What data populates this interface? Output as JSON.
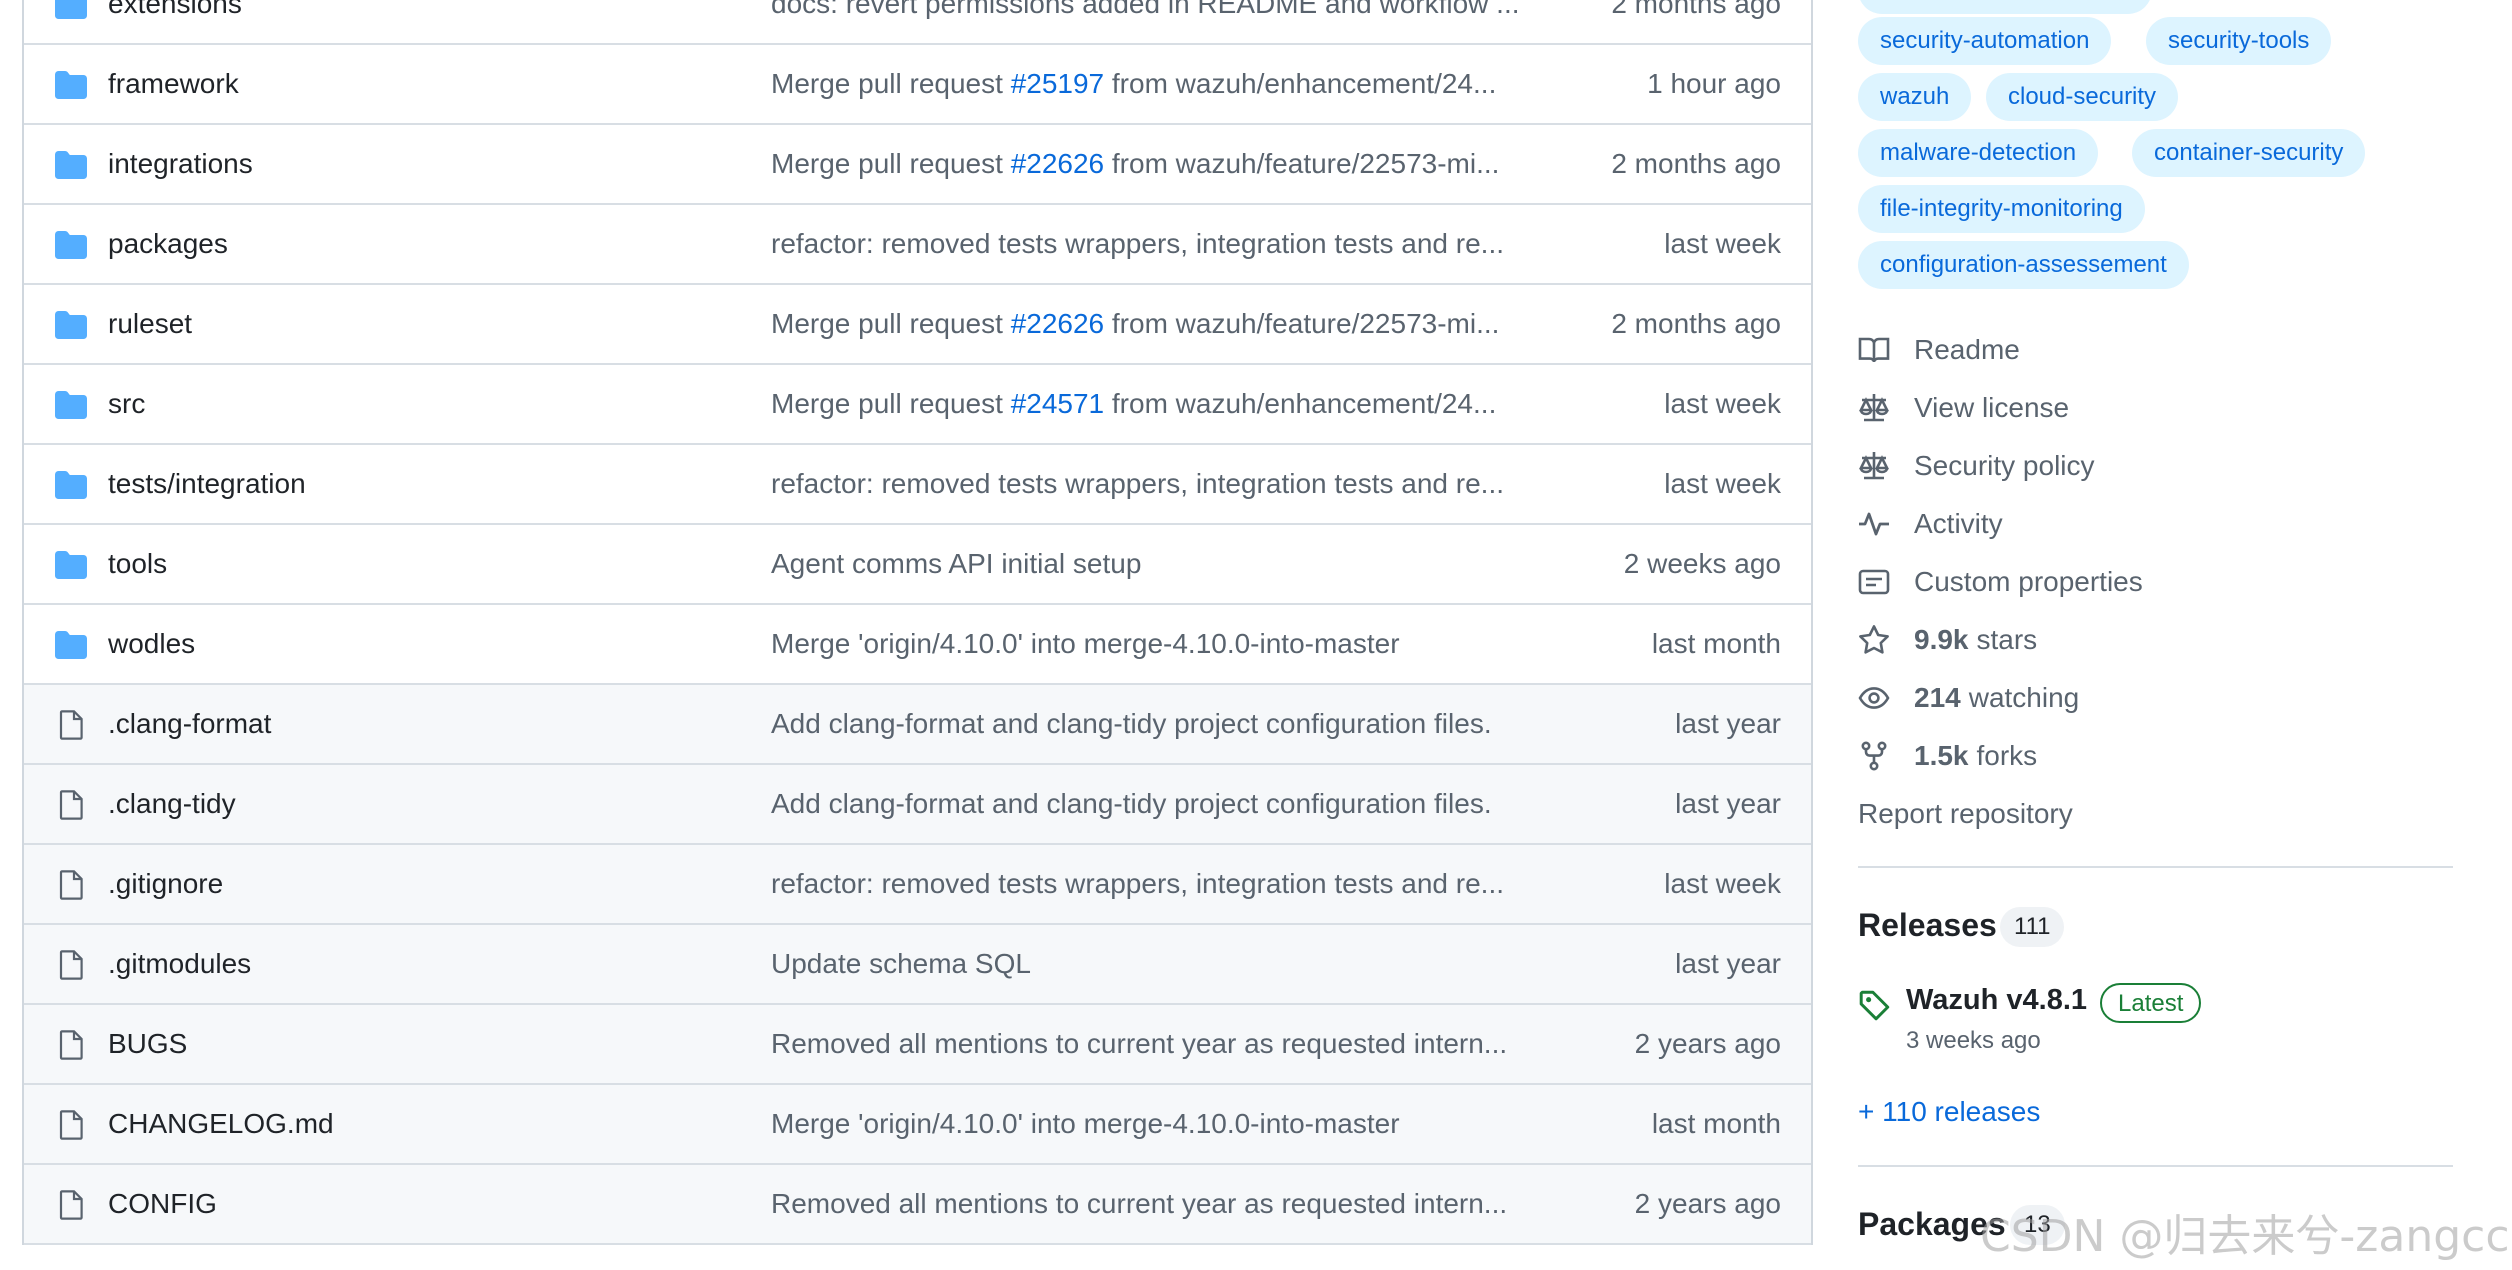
{
  "files": [
    {
      "type": "dir",
      "name": "extensions",
      "message": "docs: revert permissions added in README and workflow ...",
      "message_parts": [],
      "age": "2 months ago"
    },
    {
      "type": "dir",
      "name": "framework",
      "message_pre": "Merge pull request ",
      "pr": "#25197",
      "message_post": " from wazuh/enhancement/24...",
      "age": "1 hour ago"
    },
    {
      "type": "dir",
      "name": "integrations",
      "message_pre": "Merge pull request ",
      "pr": "#22626",
      "message_post": " from wazuh/feature/22573-mi...",
      "age": "2 months ago"
    },
    {
      "type": "dir",
      "name": "packages",
      "message": "refactor: removed tests wrappers, integration tests and re...",
      "age": "last week"
    },
    {
      "type": "dir",
      "name": "ruleset",
      "message_pre": "Merge pull request ",
      "pr": "#22626",
      "message_post": " from wazuh/feature/22573-mi...",
      "age": "2 months ago"
    },
    {
      "type": "dir",
      "name": "src",
      "message_pre": "Merge pull request ",
      "pr": "#24571",
      "message_post": " from wazuh/enhancement/24...",
      "age": "last week"
    },
    {
      "type": "dir",
      "name": "tests/integration",
      "message": "refactor: removed tests wrappers, integration tests and re...",
      "age": "last week"
    },
    {
      "type": "dir",
      "name": "tools",
      "message": "Agent comms API initial setup",
      "age": "2 weeks ago"
    },
    {
      "type": "dir",
      "name": "wodles",
      "message": "Merge 'origin/4.10.0' into merge-4.10.0-into-master",
      "age": "last month"
    },
    {
      "type": "file",
      "name": ".clang-format",
      "message": "Add clang-format and clang-tidy project configuration files.",
      "age": "last year"
    },
    {
      "type": "file",
      "name": ".clang-tidy",
      "message": "Add clang-format and clang-tidy project configuration files.",
      "age": "last year"
    },
    {
      "type": "file",
      "name": ".gitignore",
      "message": "refactor: removed tests wrappers, integration tests and re...",
      "age": "last week"
    },
    {
      "type": "file",
      "name": ".gitmodules",
      "message": "Update schema SQL",
      "age": "last year"
    },
    {
      "type": "file",
      "name": "BUGS",
      "message": "Removed all mentions to current year as requested intern...",
      "age": "2 years ago"
    },
    {
      "type": "file",
      "name": "CHANGELOG.md",
      "message": "Merge 'origin/4.10.0' into merge-4.10.0-into-master",
      "age": "last month"
    },
    {
      "type": "file",
      "name": "CONFIG",
      "message": "Removed all mentions to current year as requested intern...",
      "age": "2 years ago"
    }
  ],
  "topics": [
    "security-automation",
    "security-tools",
    "wazuh",
    "cloud-security",
    "malware-detection",
    "container-security",
    "file-integrity-monitoring",
    "configuration-assessement"
  ],
  "about_links": {
    "readme": "Readme",
    "license": "View license",
    "security": "Security policy",
    "activity": "Activity",
    "custom_properties": "Custom properties",
    "stars_count": "9.9k",
    "stars_label": "stars",
    "watching_count": "214",
    "watching_label": "watching",
    "forks_count": "1.5k",
    "forks_label": "forks",
    "report": "Report repository"
  },
  "releases": {
    "heading": "Releases",
    "count": "111",
    "latest_name": "Wazuh v4.8.1",
    "latest_badge": "Latest",
    "latest_age": "3 weeks ago",
    "more_link": "+ 110 releases"
  },
  "packages": {
    "heading": "Packages",
    "count": "13"
  },
  "watermark": "CSDN @归去来兮-zangcc",
  "colors": {
    "link": "#0969da",
    "folder": "#54aeff",
    "latest": "#1a7f37",
    "topic_bg": "#ddf4ff"
  }
}
